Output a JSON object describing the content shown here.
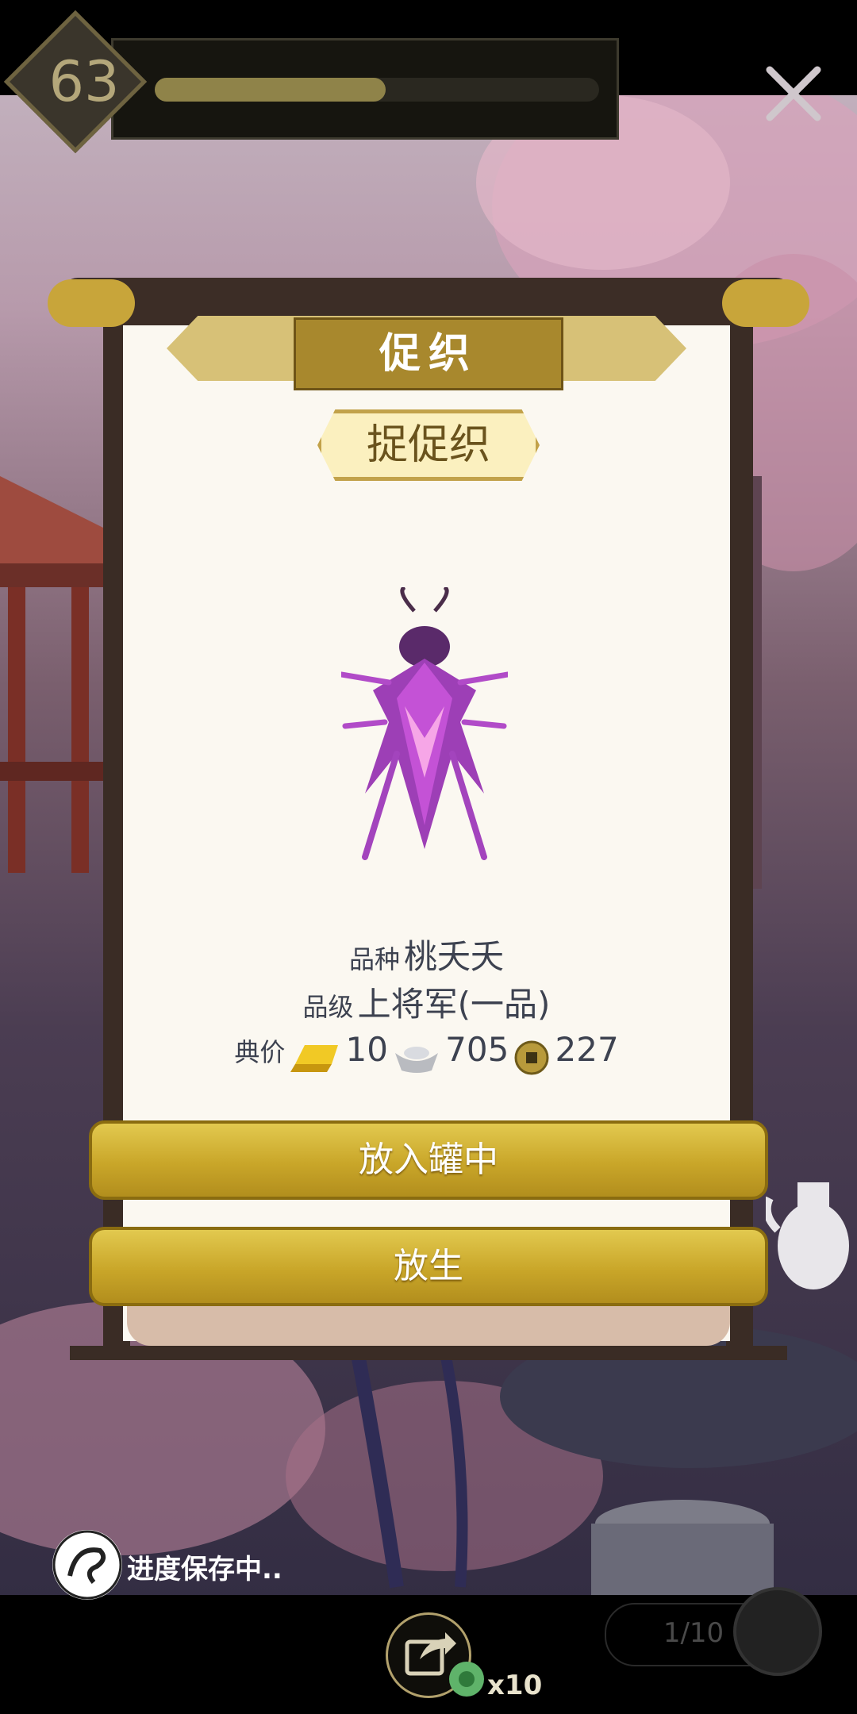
{
  "player": {
    "level": "63",
    "xp_progress": 0.52
  },
  "panel": {
    "title": "促织",
    "cricket_name": "捉促织"
  },
  "info": {
    "breed_label": "品种",
    "breed_value": "桃夭夭",
    "rank_label": "品级",
    "rank_value": "上将军(一品)",
    "price_label": "典价",
    "gold": "10",
    "silver": "705",
    "copper": "227"
  },
  "actions": {
    "put_in_jar": "放入罐中",
    "release": "放生"
  },
  "footer": {
    "save_status": "进度保存中..",
    "share_count": "x10",
    "page": "1/10"
  },
  "colors": {
    "gold_button": "#c9a629",
    "panel_bg": "#fbf8f1",
    "accent_text": "#6a531d"
  }
}
